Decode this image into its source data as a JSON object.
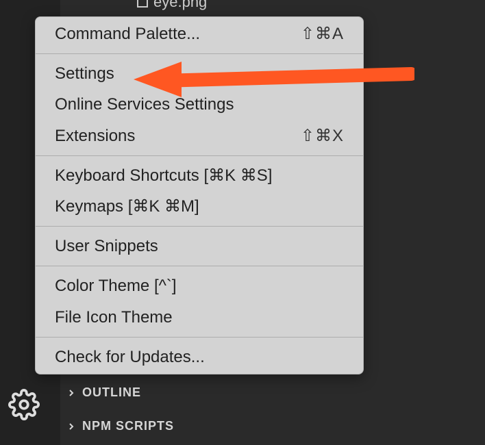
{
  "background_file": "eye.png",
  "menu": {
    "command_palette": {
      "label": "Command Palette...",
      "shortcut": "⇧⌘A"
    },
    "settings": {
      "label": "Settings"
    },
    "online_services": {
      "label": "Online Services Settings"
    },
    "extensions": {
      "label": "Extensions",
      "shortcut": "⇧⌘X"
    },
    "keyboard_shortcuts": {
      "label": "Keyboard Shortcuts [⌘K ⌘S]"
    },
    "keymaps": {
      "label": "Keymaps [⌘K ⌘M]"
    },
    "user_snippets": {
      "label": "User Snippets"
    },
    "color_theme": {
      "label": "Color Theme [^`]"
    },
    "file_icon_theme": {
      "label": "File Icon Theme"
    },
    "check_updates": {
      "label": "Check for Updates..."
    }
  },
  "sidebar": {
    "outline": "OUTLINE",
    "npm_scripts": "NPM SCRIPTS"
  },
  "annotation": {
    "arrow_color": "#ff5722"
  }
}
